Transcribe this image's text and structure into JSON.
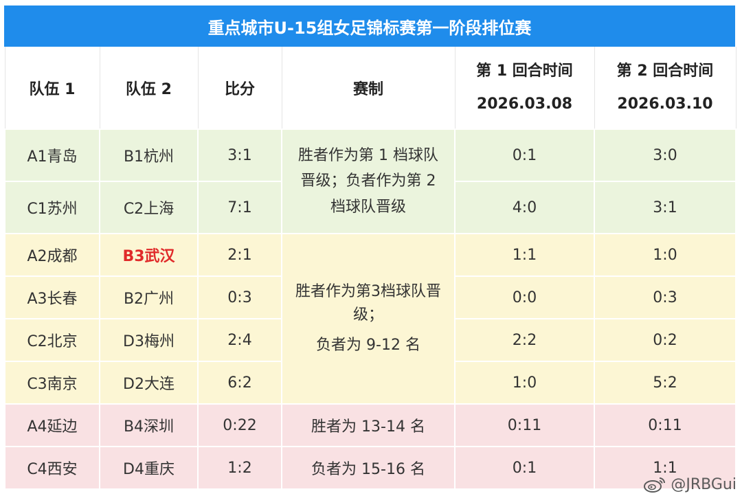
{
  "title": "重点城市U-15组女足锦标赛第一阶段排位赛",
  "headers": {
    "team1": "队伍 1",
    "team2": "队伍 2",
    "score": "比分",
    "format": "赛制",
    "round1_label": "第 1 回合时间",
    "round1_date": "2026.03.08",
    "round2_label": "第 2 回合时间",
    "round2_date": "2026.03.10"
  },
  "groups": [
    {
      "format": "胜者作为第 1 档球队晋级；负者作为第 2 档球队晋级",
      "rows": [
        {
          "team1": "A1青岛",
          "team2": "B1杭州",
          "score": "3:1",
          "r1": "0:1",
          "r2": "3:0"
        },
        {
          "team1": "C1苏州",
          "team2": "C2上海",
          "score": "7:1",
          "r1": "4:0",
          "r2": "3:1"
        }
      ]
    },
    {
      "format_line1": "胜者作为第3档球队晋级；",
      "format_line2": "负者为 9-12 名",
      "rows": [
        {
          "team1": "A2成都",
          "team2": "B3武汉",
          "score": "2:1",
          "r1": "1:1",
          "r2": "1:0"
        },
        {
          "team1": "A3长春",
          "team2": "B2广州",
          "score": "0:3",
          "r1": "0:0",
          "r2": "0:3"
        },
        {
          "team1": "C2北京",
          "team2": "D3梅州",
          "score": "2:4",
          "r1": "2:2",
          "r2": "0:2"
        },
        {
          "team1": "C3南京",
          "team2": "D2大连",
          "score": "6:2",
          "r1": "1:0",
          "r2": "5:2"
        }
      ]
    },
    {
      "format_row1": "胜者为 13-14 名",
      "format_row2": "负者为 15-16 名",
      "rows": [
        {
          "team1": "A4延边",
          "team2": "B4深圳",
          "score": "0:22",
          "r1": "0:11",
          "r2": "0:11"
        },
        {
          "team1": "C4西安",
          "team2": "D4重庆",
          "score": "1:2",
          "r1": "0:1",
          "r2": "1:1"
        }
      ]
    }
  ],
  "colors": {
    "title_bg": "#1f8ceb",
    "group1_bg": "#ebf4dd",
    "group2_bg": "#fcf6d4",
    "group3_bg": "#f9e1e3",
    "highlight_text": "#e02a2a"
  },
  "watermark": "@JRBGui",
  "watermark_icon": "weibo-icon"
}
